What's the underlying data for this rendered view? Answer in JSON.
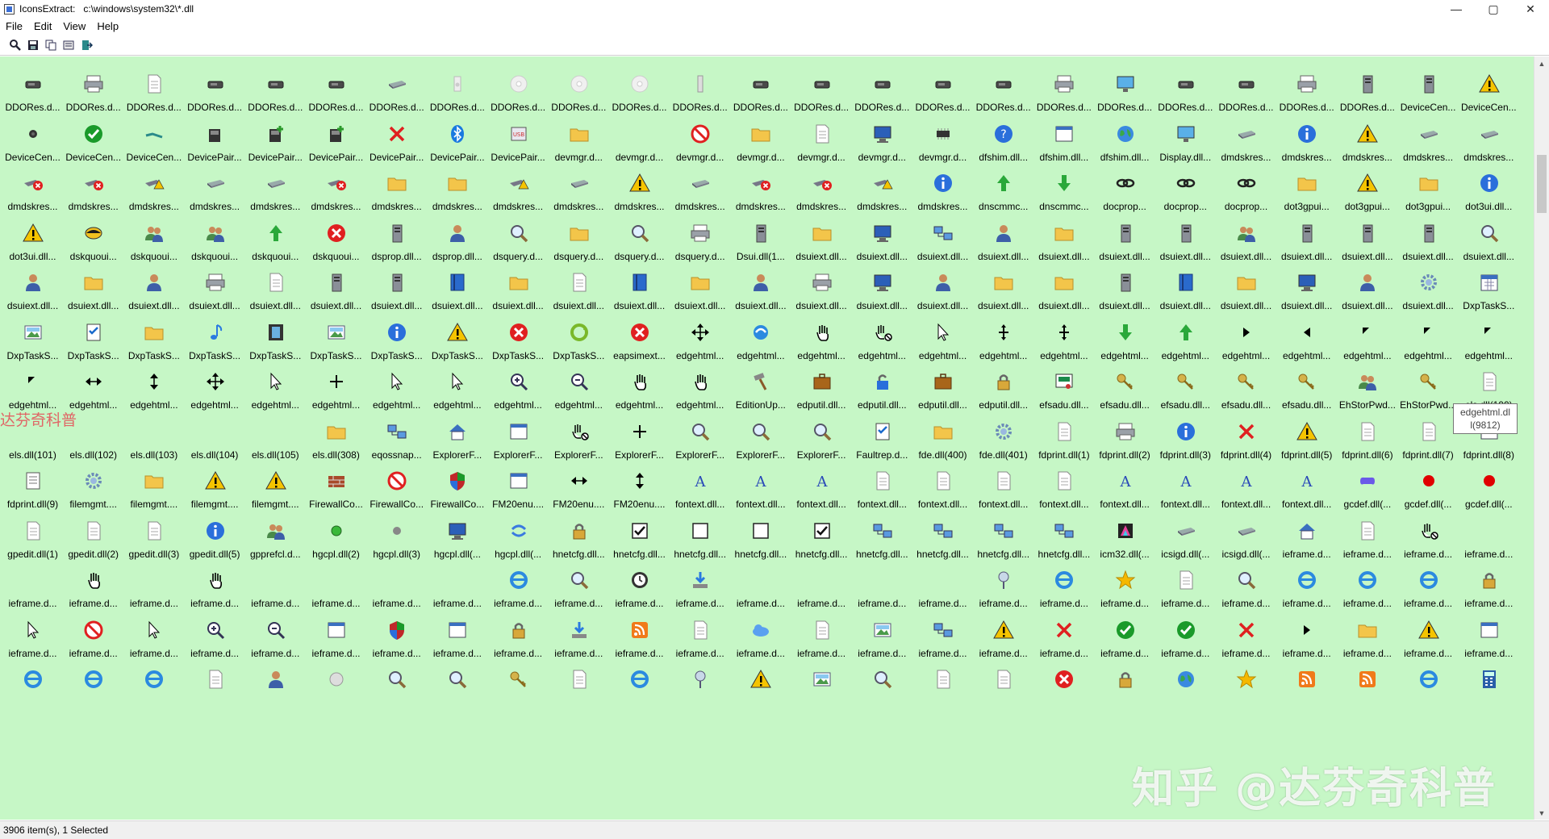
{
  "window": {
    "title": "IconsExtract:   c:\\windows\\system32\\*.dll",
    "minimize": "—",
    "maximize": "▢",
    "close": "✕"
  },
  "menu": [
    "File",
    "Edit",
    "View",
    "Help"
  ],
  "toolbar": [
    "magnifier-icon",
    "save-icon",
    "copy-icon",
    "properties-icon",
    "exit-icon"
  ],
  "colors": {
    "list_background": "#c6f7c6",
    "accent_blue": "#2a6fdb",
    "warning_yellow": "#f5c400",
    "error_red": "#e02020",
    "ok_green": "#1a9a2a"
  },
  "list": {
    "rows": [
      [
        "DDORes.d...",
        "DDORes.d...",
        "DDORes.d...",
        "DDORes.d...",
        "DDORes.d...",
        "DDORes.d...",
        "DDORes.d...",
        "DDORes.d...",
        "DDORes.d...",
        "DDORes.d...",
        "DDORes.d...",
        "DDORes.d...",
        "DDORes.d...",
        "DDORes.d...",
        "DDORes.d...",
        "DDORes.d...",
        "DDORes.d...",
        "DDORes.d...",
        "DDORes.d...",
        "DDORes.d...",
        "DDORes.d...",
        "DDORes.d...",
        "DDORes.d...",
        "DeviceCen...",
        "DeviceCen..."
      ],
      [
        "DeviceCen...",
        "DeviceCen...",
        "DeviceCen...",
        "DevicePair...",
        "DevicePair...",
        "DevicePair...",
        "DevicePair...",
        "DevicePair...",
        "DevicePair...",
        "devmgr.d...",
        "devmgr.d...",
        "devmgr.d...",
        "devmgr.d...",
        "devmgr.d...",
        "devmgr.d...",
        "devmgr.d...",
        "dfshim.dll...",
        "dfshim.dll...",
        "dfshim.dll...",
        "Display.dll...",
        "dmdskres...",
        "dmdskres...",
        "dmdskres...",
        "dmdskres...",
        "dmdskres..."
      ],
      [
        "dmdskres...",
        "dmdskres...",
        "dmdskres...",
        "dmdskres...",
        "dmdskres...",
        "dmdskres...",
        "dmdskres...",
        "dmdskres...",
        "dmdskres...",
        "dmdskres...",
        "dmdskres...",
        "dmdskres...",
        "dmdskres...",
        "dmdskres...",
        "dmdskres...",
        "dmdskres...",
        "dnscmmc...",
        "dnscmmc...",
        "docprop...",
        "docprop...",
        "docprop...",
        "dot3gpui...",
        "dot3gpui...",
        "dot3gpui...",
        "dot3ui.dll..."
      ],
      [
        "dot3ui.dll...",
        "dskquoui...",
        "dskquoui...",
        "dskquoui...",
        "dskquoui...",
        "dskquoui...",
        "dsprop.dll...",
        "dsprop.dll...",
        "dsquery.d...",
        "dsquery.d...",
        "dsquery.d...",
        "dsquery.d...",
        "Dsui.dll(1...",
        "dsuiext.dll...",
        "dsuiext.dll...",
        "dsuiext.dll...",
        "dsuiext.dll...",
        "dsuiext.dll...",
        "dsuiext.dll...",
        "dsuiext.dll...",
        "dsuiext.dll...",
        "dsuiext.dll...",
        "dsuiext.dll...",
        "dsuiext.dll...",
        "dsuiext.dll..."
      ],
      [
        "dsuiext.dll...",
        "dsuiext.dll...",
        "dsuiext.dll...",
        "dsuiext.dll...",
        "dsuiext.dll...",
        "dsuiext.dll...",
        "dsuiext.dll...",
        "dsuiext.dll...",
        "dsuiext.dll...",
        "dsuiext.dll...",
        "dsuiext.dll...",
        "dsuiext.dll...",
        "dsuiext.dll...",
        "dsuiext.dll...",
        "dsuiext.dll...",
        "dsuiext.dll...",
        "dsuiext.dll...",
        "dsuiext.dll...",
        "dsuiext.dll...",
        "dsuiext.dll...",
        "dsuiext.dll...",
        "dsuiext.dll...",
        "dsuiext.dll...",
        "dsuiext.dll...",
        "DxpTaskS..."
      ],
      [
        "DxpTaskS...",
        "DxpTaskS...",
        "DxpTaskS...",
        "DxpTaskS...",
        "DxpTaskS...",
        "DxpTaskS...",
        "DxpTaskS...",
        "DxpTaskS...",
        "DxpTaskS...",
        "DxpTaskS...",
        "eapsimext...",
        "edgehtml...",
        "edgehtml...",
        "edgehtml...",
        "edgehtml...",
        "edgehtml...",
        "edgehtml...",
        "edgehtml...",
        "edgehtml...",
        "edgehtml...",
        "edgehtml...",
        "edgehtml...",
        "edgehtml...",
        "edgehtml...",
        "edgehtml..."
      ],
      [
        "edgehtml...",
        "edgehtml...",
        "edgehtml...",
        "edgehtml...",
        "edgehtml...",
        "edgehtml...",
        "edgehtml...",
        "edgehtml...",
        "edgehtml...",
        "edgehtml...",
        "edgehtml...",
        "edgehtml...",
        "EditionUp...",
        "edputil.dll...",
        "edputil.dll...",
        "edputil.dll...",
        "edputil.dll...",
        "efsadu.dll...",
        "efsadu.dll...",
        "efsadu.dll...",
        "efsadu.dll...",
        "efsadu.dll...",
        "EhStorPwd...",
        "EhStorPwd...",
        "els.dll(100)"
      ],
      [
        "els.dll(101)",
        "els.dll(102)",
        "els.dll(103)",
        "els.dll(104)",
        "els.dll(105)",
        "els.dll(308)",
        "eqossnap...",
        "ExplorerF...",
        "ExplorerF...",
        "ExplorerF...",
        "ExplorerF...",
        "ExplorerF...",
        "ExplorerF...",
        "ExplorerF...",
        "Faultrep.d...",
        "fde.dll(400)",
        "fde.dll(401)",
        "fdprint.dll(1)",
        "fdprint.dll(2)",
        "fdprint.dll(3)",
        "fdprint.dll(4)",
        "fdprint.dll(5)",
        "fdprint.dll(6)",
        "fdprint.dll(7)",
        "fdprint.dll(8)"
      ],
      [
        "fdprint.dll(9)",
        "filemgmt....",
        "filemgmt....",
        "filemgmt....",
        "filemgmt....",
        "FirewallCo...",
        "FirewallCo...",
        "FirewallCo...",
        "FM20enu....",
        "FM20enu....",
        "FM20enu....",
        "fontext.dll...",
        "fontext.dll...",
        "fontext.dll...",
        "fontext.dll...",
        "fontext.dll...",
        "fontext.dll...",
        "fontext.dll...",
        "fontext.dll...",
        "fontext.dll...",
        "fontext.dll...",
        "fontext.dll...",
        "gcdef.dll(...",
        "gcdef.dll(...",
        "gcdef.dll(..."
      ],
      [
        "gpedit.dll(1)",
        "gpedit.dll(2)",
        "gpedit.dll(3)",
        "gpedit.dll(5)",
        "gpprefcl.d...",
        "hgcpl.dll(2)",
        "hgcpl.dll(3)",
        "hgcpl.dll(...",
        "hgcpl.dll(...",
        "hnetcfg.dll...",
        "hnetcfg.dll...",
        "hnetcfg.dll...",
        "hnetcfg.dll...",
        "hnetcfg.dll...",
        "hnetcfg.dll...",
        "hnetcfg.dll...",
        "hnetcfg.dll...",
        "hnetcfg.dll...",
        "icm32.dll(...",
        "icsigd.dll(...",
        "icsigd.dll(...",
        "ieframe.d...",
        "ieframe.d...",
        "ieframe.d...",
        "ieframe.d..."
      ],
      [
        "ieframe.d...",
        "ieframe.d...",
        "ieframe.d...",
        "ieframe.d...",
        "ieframe.d...",
        "ieframe.d...",
        "ieframe.d...",
        "ieframe.d...",
        "ieframe.d...",
        "ieframe.d...",
        "ieframe.d...",
        "ieframe.d...",
        "ieframe.d...",
        "ieframe.d...",
        "ieframe.d...",
        "ieframe.d...",
        "ieframe.d...",
        "ieframe.d...",
        "ieframe.d...",
        "ieframe.d...",
        "ieframe.d...",
        "ieframe.d...",
        "ieframe.d...",
        "ieframe.d...",
        "ieframe.d..."
      ],
      [
        "ieframe.d...",
        "ieframe.d...",
        "ieframe.d...",
        "ieframe.d...",
        "ieframe.d...",
        "ieframe.d...",
        "ieframe.d...",
        "ieframe.d...",
        "ieframe.d...",
        "ieframe.d...",
        "ieframe.d...",
        "ieframe.d...",
        "ieframe.d...",
        "ieframe.d...",
        "ieframe.d...",
        "ieframe.d...",
        "ieframe.d...",
        "ieframe.d...",
        "ieframe.d...",
        "ieframe.d...",
        "ieframe.d...",
        "ieframe.d...",
        "ieframe.d...",
        "ieframe.d...",
        "ieframe.d..."
      ],
      [
        "",
        "",
        "",
        "",
        "",
        "",
        "",
        "",
        "",
        "",
        "",
        "",
        "",
        "",
        "",
        "",
        "",
        "",
        "",
        "",
        "",
        "",
        "",
        "",
        ""
      ]
    ],
    "icons": [
      [
        "projector-icon",
        "printer-icon",
        "document-icon",
        "scanner-icon",
        "camera-icon",
        "fax-icon",
        "drive-icon",
        "speaker-icon",
        "disc-icon",
        "disc-icon",
        "disc-icon",
        "usb-stick-icon",
        "hair-dryer-icon",
        "game-controller-icon",
        "mouse-icon",
        "keyboard-icon",
        "phone-icon",
        "printer-icon",
        "monitor-icon",
        "fax-icon",
        "mouse-icon",
        "printer-icon",
        "server-icon",
        "server-icon",
        "warning-icon"
      ],
      [
        "webcam-icon",
        "checkmark-icon",
        "network-cable-icon",
        "device-icon",
        "device-add-icon",
        "device-add-icon",
        "cross-icon",
        "bluetooth-icon",
        "usb-icon",
        "folder-icon",
        "blank-icon",
        "no-entry-icon",
        "folder-icon",
        "document-icon",
        "computer-icon",
        "chip-icon",
        "help-icon",
        "window-icon",
        "globe-icon",
        "monitor-icon",
        "drive-icon",
        "info-icon",
        "warning-icon",
        "drive-icon",
        "drive-icon"
      ],
      [
        "drive-error-icon",
        "drive-error-icon",
        "drive-warning-icon",
        "drive-icon",
        "drive-icon",
        "drive-error-icon",
        "folder-icon",
        "folder-icon",
        "drive-warning-icon",
        "drive-icon",
        "warning-icon",
        "drive-icon",
        "drive-error-icon",
        "drive-error-icon",
        "drive-warning-icon",
        "info-icon",
        "arrow-up-icon",
        "arrow-down-icon",
        "chain-icon",
        "chain-icon",
        "chain-icon",
        "folder-icon",
        "warning-icon",
        "folder-icon",
        "info-icon"
      ],
      [
        "warning-icon",
        "disk-icon",
        "users-icon",
        "users-icon",
        "arrow-up-icon",
        "error-icon",
        "server-icon",
        "user-icon",
        "search-icon",
        "folder-icon",
        "search-icon",
        "printer-icon",
        "server-icon",
        "folder-icon",
        "computer-icon",
        "network-icon",
        "user-icon",
        "folder-icon",
        "server-icon",
        "server-icon",
        "users-icon",
        "server-icon",
        "server-icon",
        "server-icon",
        "search-icon"
      ],
      [
        "user-icon",
        "folder-icon",
        "user-icon",
        "printer-icon",
        "document-icon",
        "server-icon",
        "server-icon",
        "book-icon",
        "folder-icon",
        "document-icon",
        "book-icon",
        "folder-icon",
        "user-icon",
        "printer-icon",
        "computer-icon",
        "user-icon",
        "folder-icon",
        "folder-icon",
        "server-icon",
        "book-icon",
        "folder-icon",
        "computer-icon",
        "user-icon",
        "gear-icon",
        "calendar-icon"
      ],
      [
        "photo-icon",
        "checklist-icon",
        "folder-icon",
        "music-icon",
        "film-icon",
        "picture-icon",
        "info-icon",
        "warning-icon",
        "error-icon",
        "sync-icon",
        "error-icon",
        "move-icon",
        "edge-icon",
        "hand-pointer-icon",
        "hand-no-icon",
        "cursor-icon",
        "split-icon",
        "split-icon",
        "arrow-down-icon",
        "arrow-up-icon",
        "arrow-right-icon",
        "arrow-left-icon",
        "arrow-diag-icon",
        "arrow-diag-icon",
        "arrow-diag-icon"
      ],
      [
        "arrow-diag-icon",
        "arrow-horizontal-icon",
        "arrow-vertical-icon",
        "move-icon",
        "cursor-icon",
        "crosshair-icon",
        "cursor-icon",
        "cursor-icon",
        "zoom-in-icon",
        "zoom-out-icon",
        "hand-icon",
        "hand-icon",
        "hammer-icon",
        "briefcase-icon",
        "lock-open-icon",
        "briefcase-icon",
        "lock-icon",
        "certificate-icon",
        "key-icon",
        "key-icon",
        "key-icon",
        "key-icon",
        "users-icon",
        "key-icon",
        "document-icon"
      ],
      [
        "blank-icon",
        "blank-icon",
        "blank-icon",
        "blank-icon",
        "blank-icon",
        "folder-icon",
        "network-icon",
        "house-icon",
        "window-icon",
        "hand-no-icon",
        "crosshair-icon",
        "search-icon",
        "search-icon",
        "search-icon",
        "checklist-icon",
        "folder-icon",
        "gear-icon",
        "document-icon",
        "printer-icon",
        "info-icon",
        "cross-icon",
        "warning-icon",
        "document-icon",
        "document-icon",
        "window-icon"
      ],
      [
        "list-icon",
        "gear-icon",
        "folder-icon",
        "warning-icon",
        "warning-icon",
        "firewall-icon",
        "no-entry-icon",
        "shield-icon",
        "window-icon",
        "arrow-horizontal-icon",
        "arrow-vertical-icon",
        "font-icon",
        "font-icon",
        "font-icon",
        "document-icon",
        "document-icon",
        "document-icon",
        "document-icon",
        "font-icon",
        "font-icon",
        "font-icon",
        "font-icon",
        "gamepad-icon",
        "red-dot-icon",
        "red-dot-icon"
      ],
      [
        "document-icon",
        "document-icon",
        "document-icon",
        "info-icon",
        "users-icon",
        "green-dot-icon",
        "gray-dot-icon",
        "computer-icon",
        "arrows-icon",
        "lock-icon",
        "checkbox-icon",
        "checkbox-empty-icon",
        "checkbox-empty-icon",
        "checkbox-icon",
        "network-icon",
        "network-icon",
        "network-icon",
        "network-icon",
        "color-icon",
        "drive-icon",
        "drive-icon",
        "house-icon",
        "document-icon",
        "hand-no-icon",
        "blank-icon"
      ],
      [
        "blank-icon",
        "hand-icon",
        "blank-icon",
        "hand-icon",
        "blank-icon",
        "blank-icon",
        "blank-icon",
        "blank-icon",
        "ie-icon",
        "search-icon",
        "clock-icon",
        "download-icon",
        "blank-icon",
        "blank-icon",
        "blank-icon",
        "blank-icon",
        "pin-icon",
        "ie-icon",
        "star-icon",
        "document-icon",
        "search-icon",
        "ie-icon",
        "ie-icon",
        "ie-icon",
        "lock-icon"
      ],
      [
        "cursor-icon",
        "no-entry-icon",
        "cursor-icon",
        "zoom-in-icon",
        "zoom-out-icon",
        "window-icon",
        "shield-icon",
        "window-icon",
        "lock-icon",
        "download-icon",
        "rss-icon",
        "document-icon",
        "cloud-icon",
        "document-icon",
        "picture-icon",
        "network-icon",
        "warning-icon",
        "cross-icon",
        "checkmark-icon",
        "checkmark-icon",
        "cross-icon",
        "arrow-right-icon",
        "folder-icon",
        "warning-icon",
        "window-icon"
      ],
      [
        "ie-icon",
        "ie-icon",
        "ie-icon",
        "document-icon",
        "user-icon",
        "circle-icon",
        "search-icon",
        "search-icon",
        "key-icon",
        "document-icon",
        "ie-icon",
        "pin-icon",
        "warning-icon",
        "picture-icon",
        "search-icon",
        "document-icon",
        "document-icon",
        "error-icon",
        "lock-icon",
        "globe-icon",
        "star-icon",
        "rss-icon",
        "rss-icon",
        "ie-icon",
        "calculator-icon"
      ]
    ]
  },
  "tooltip": {
    "line1": "edgehtml.dl",
    "line2": "l(9812)"
  },
  "status": {
    "text": "3906 item(s), 1 Selected"
  },
  "watermark": {
    "left": "达芬奇科普",
    "right": "知乎 @达芬奇科普"
  }
}
